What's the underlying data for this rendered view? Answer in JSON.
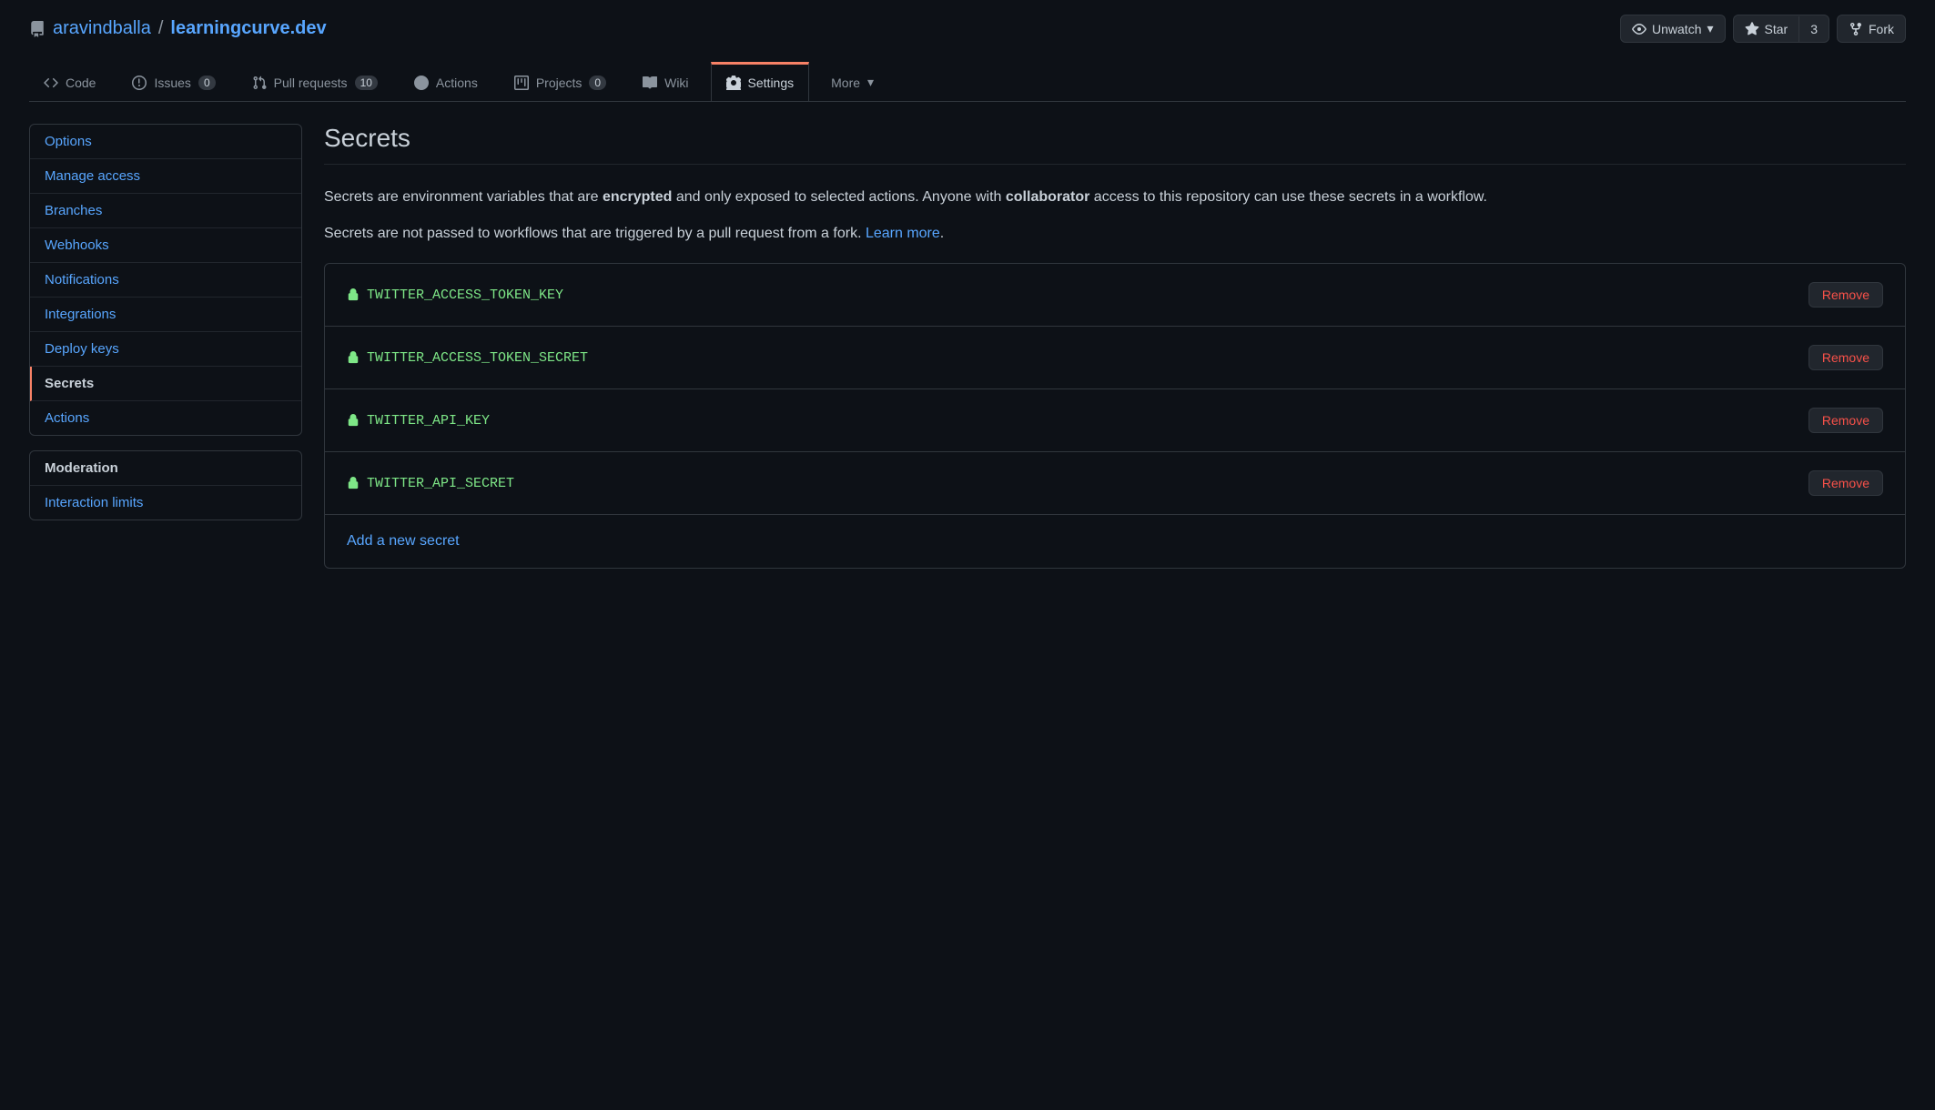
{
  "repo": {
    "owner": "aravindballa",
    "name": "learningcurve.dev"
  },
  "actions": {
    "unwatch": "Unwatch",
    "star": "Star",
    "star_count": "3",
    "fork": "Fork"
  },
  "tabs": {
    "code": "Code",
    "issues": "Issues",
    "issues_count": "0",
    "pulls": "Pull requests",
    "pulls_count": "10",
    "actions": "Actions",
    "projects": "Projects",
    "projects_count": "0",
    "wiki": "Wiki",
    "settings": "Settings",
    "more": "More"
  },
  "sidebar": {
    "items": [
      "Options",
      "Manage access",
      "Branches",
      "Webhooks",
      "Notifications",
      "Integrations",
      "Deploy keys",
      "Secrets",
      "Actions"
    ],
    "moderation_heading": "Moderation",
    "moderation_items": [
      "Interaction limits"
    ]
  },
  "content": {
    "title": "Secrets",
    "desc_part1": "Secrets are environment variables that are ",
    "desc_bold1": "encrypted",
    "desc_part2": " and only exposed to selected actions. Anyone with ",
    "desc_bold2": "collaborator",
    "desc_part3": " access to this repository can use these secrets in a workflow.",
    "desc2_part1": "Secrets are not passed to workflows that are triggered by a pull request from a fork. ",
    "desc2_link": "Learn more",
    "desc2_part2": ".",
    "secrets": [
      {
        "name": "TWITTER_ACCESS_TOKEN_KEY",
        "remove": "Remove"
      },
      {
        "name": "TWITTER_ACCESS_TOKEN_SECRET",
        "remove": "Remove"
      },
      {
        "name": "TWITTER_API_KEY",
        "remove": "Remove"
      },
      {
        "name": "TWITTER_API_SECRET",
        "remove": "Remove"
      }
    ],
    "add_secret": "Add a new secret"
  }
}
